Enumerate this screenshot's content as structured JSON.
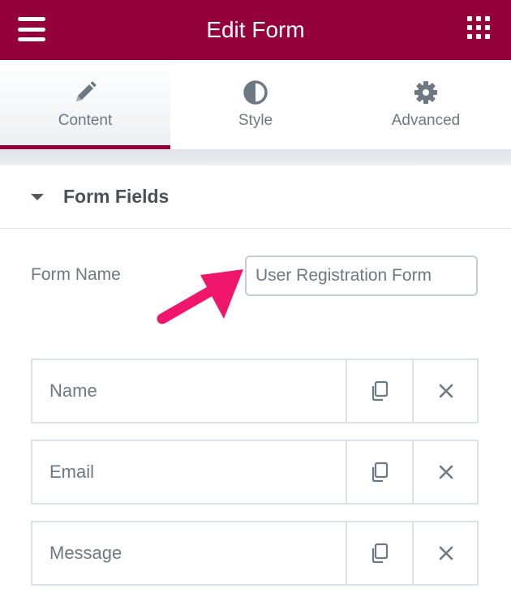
{
  "header": {
    "title": "Edit Form",
    "menu_icon": "hamburger-icon",
    "apps_icon": "grid-icon",
    "background": "#93003a"
  },
  "tabs": [
    {
      "label": "Content",
      "icon": "pencil-icon",
      "active": true
    },
    {
      "label": "Style",
      "icon": "half-circle-icon",
      "active": false
    },
    {
      "label": "Advanced",
      "icon": "gear-icon",
      "active": false
    }
  ],
  "section": {
    "title": "Form Fields",
    "expanded": true
  },
  "form_name": {
    "label": "Form Name",
    "value": "User Registration Form"
  },
  "annotation": {
    "arrow_color": "#f0166c"
  },
  "fields": [
    {
      "label": "Name",
      "duplicate_icon": "copy-icon",
      "remove_icon": "close-icon"
    },
    {
      "label": "Email",
      "duplicate_icon": "copy-icon",
      "remove_icon": "close-icon"
    },
    {
      "label": "Message",
      "duplicate_icon": "copy-icon",
      "remove_icon": "close-icon"
    }
  ],
  "colors": {
    "accent": "#93003a",
    "text": "#6d7882",
    "border": "#dde1e5"
  }
}
